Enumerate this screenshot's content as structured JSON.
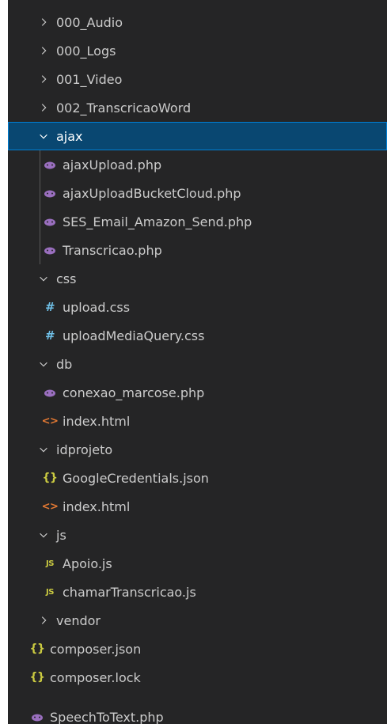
{
  "explorer": {
    "items": [
      {
        "label": "000_Audio",
        "kind": "folder",
        "expanded": false,
        "icon": "chevron-right-icon"
      },
      {
        "label": "000_Logs",
        "kind": "folder",
        "expanded": false,
        "icon": "chevron-right-icon"
      },
      {
        "label": "001_Video",
        "kind": "folder",
        "expanded": false,
        "icon": "chevron-right-icon"
      },
      {
        "label": "002_TranscricaoWord",
        "kind": "folder",
        "expanded": false,
        "icon": "chevron-right-icon"
      },
      {
        "label": "ajax",
        "kind": "folder",
        "expanded": true,
        "selected": true,
        "icon": "chevron-down-icon"
      },
      {
        "label": "ajaxUpload.php",
        "kind": "file",
        "icon": "php-icon"
      },
      {
        "label": "ajaxUploadBucketCloud.php",
        "kind": "file",
        "icon": "php-icon"
      },
      {
        "label": "SES_Email_Amazon_Send.php",
        "kind": "file",
        "icon": "php-icon"
      },
      {
        "label": "Transcricao.php",
        "kind": "file",
        "icon": "php-icon"
      },
      {
        "label": "css",
        "kind": "folder",
        "expanded": true,
        "icon": "chevron-down-icon"
      },
      {
        "label": "upload.css",
        "kind": "file",
        "icon": "css-icon",
        "glyph": "#"
      },
      {
        "label": "uploadMediaQuery.css",
        "kind": "file",
        "icon": "css-icon",
        "glyph": "#"
      },
      {
        "label": "db",
        "kind": "folder",
        "expanded": true,
        "icon": "chevron-down-icon"
      },
      {
        "label": "conexao_marcose.php",
        "kind": "file",
        "icon": "php-icon"
      },
      {
        "label": "index.html",
        "kind": "file",
        "icon": "html-icon",
        "glyph": "<>"
      },
      {
        "label": "idprojeto",
        "kind": "folder",
        "expanded": true,
        "icon": "chevron-down-icon"
      },
      {
        "label": "GoogleCredentials.json",
        "kind": "file",
        "icon": "json-icon",
        "glyph": "{}"
      },
      {
        "label": "index.html",
        "kind": "file",
        "icon": "html-icon",
        "glyph": "<>"
      },
      {
        "label": "js",
        "kind": "folder",
        "expanded": true,
        "icon": "chevron-down-icon"
      },
      {
        "label": "Apoio.js",
        "kind": "file",
        "icon": "js-icon",
        "glyph": "JS"
      },
      {
        "label": "chamarTranscricao.js",
        "kind": "file",
        "icon": "js-icon",
        "glyph": "JS"
      },
      {
        "label": "vendor",
        "kind": "folder",
        "expanded": false,
        "icon": "chevron-right-icon"
      },
      {
        "label": "composer.json",
        "kind": "file",
        "icon": "json-icon",
        "glyph": "{}"
      },
      {
        "label": "composer.lock",
        "kind": "file",
        "icon": "json-icon",
        "glyph": "{}"
      },
      {
        "label": "SpeechToText.php",
        "kind": "file",
        "icon": "php-icon"
      }
    ],
    "colors": {
      "background": "#252526",
      "selected_background": "#094771",
      "selected_border": "#007fd4",
      "text": "#cccccc",
      "php_icon": "#9a6fbf",
      "css_icon": "#6fbfe6",
      "html_icon": "#e37933",
      "json_icon": "#cbcb41",
      "js_icon": "#cbcb41"
    }
  }
}
